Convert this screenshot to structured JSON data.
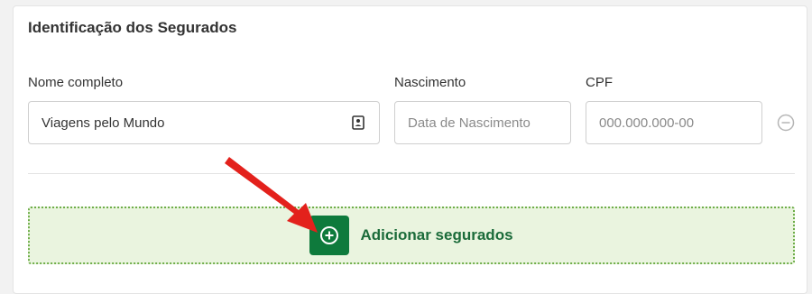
{
  "section": {
    "title": "Identificação dos Segurados"
  },
  "form": {
    "name_label": "Nome completo",
    "name_value": "Viagens pelo Mundo",
    "birth_label": "Nascimento",
    "birth_placeholder": "Data de Nascimento",
    "cpf_label": "CPF",
    "cpf_placeholder": "000.000.000-00"
  },
  "actions": {
    "add_label": "Adicionar segurados"
  },
  "colors": {
    "accent_green": "#0e7a3c",
    "add_area_bg": "#eaf4df",
    "arrow_red": "#e3211c"
  },
  "icons": {
    "name_field": "contact-card-icon",
    "remove": "minus-circle-icon",
    "add": "plus-circle-icon"
  }
}
